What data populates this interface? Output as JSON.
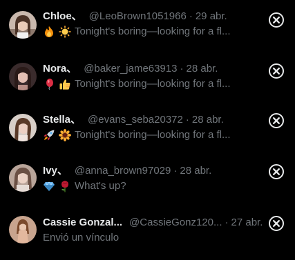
{
  "conversations": [
    {
      "name": "Chloe、",
      "handle": "@LeoBrown1051966",
      "separator": "·",
      "date": "29 abr.",
      "emojis": [
        "fire-emoji",
        "sun-emoji"
      ],
      "preview": "Tonight's boring—looking for a fl..."
    },
    {
      "name": "Nora、",
      "handle": "@baker_jame63913",
      "separator": "·",
      "date": "28 abr.",
      "emojis": [
        "red-balloon-emoji",
        "thumbs-up-emoji"
      ],
      "preview": "Tonight's boring—looking for a fl..."
    },
    {
      "name": "Stella、",
      "handle": "@evans_seba20372",
      "separator": "·",
      "date": "28 abr.",
      "emojis": [
        "rocket-emoji",
        "sunflower-emoji"
      ],
      "preview": "Tonight's boring—looking for a fl..."
    },
    {
      "name": "Ivy、",
      "handle": "@anna_brown97029",
      "separator": "·",
      "date": "28 abr.",
      "emojis": [
        "gem-emoji",
        "rose-emoji"
      ],
      "preview": "What's up?"
    },
    {
      "name": "Cassie Gonzal...",
      "handle": "@CassieGonz120...",
      "separator": "·",
      "date": "27 abr.",
      "emojis": [],
      "preview": "Envió un vínculo"
    }
  ],
  "colors": {
    "background": "#000000",
    "primary_text": "#e7e9ea",
    "secondary_text": "#71767b"
  },
  "icons": {
    "close": "close-circle-icon"
  }
}
